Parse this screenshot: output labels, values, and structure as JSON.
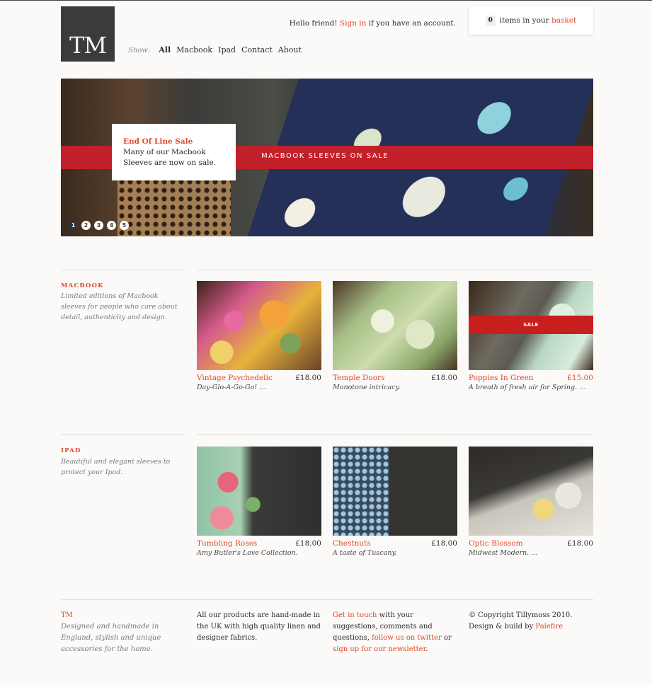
{
  "header": {
    "logo": "TM",
    "show_label": "Show:",
    "nav": [
      "All",
      "Macbook",
      "Ipad",
      "Contact",
      "About"
    ],
    "greeting_pre": "Hello friend! ",
    "sign_in": "Sign in",
    "greeting_post": " if you have an account.",
    "basket_count": "0",
    "basket_text": "items in your ",
    "basket_link": "basket"
  },
  "hero": {
    "card_title": "End Of Line Sale",
    "card_text": "Many of our Macbook Sleeves are now on sale.",
    "band_text": "MACBOOK SLEEVES ON SALE",
    "dots": [
      "1",
      "2",
      "3",
      "4",
      "5"
    ]
  },
  "sections": [
    {
      "title": "MACBOOK",
      "desc": "Limited editions of Macbook sleeves for people who care about detail, authenticity and design.",
      "products": [
        {
          "name": "Vintage Psychedelic",
          "price": "£18.00",
          "desc": "Day-Glo-A-Go-Go! …"
        },
        {
          "name": "Temple Doors",
          "price": "£18.00",
          "desc": "Monotone intricacy."
        },
        {
          "name": "Poppies In Green",
          "price": "£15.00",
          "desc": "A breath of fresh air for Spring. …",
          "badge": "SALE"
        }
      ]
    },
    {
      "title": "IPAD",
      "desc": "Beautiful and elegant sleeves to protect your Ipad.",
      "products": [
        {
          "name": "Tumbling Roses",
          "price": "£18.00",
          "desc": "Amy Butler's Love Collection."
        },
        {
          "name": "Chestnuts",
          "price": "£18.00",
          "desc": "A taste of Tuscany."
        },
        {
          "name": "Optic Blossom",
          "price": "£18.00",
          "desc": "Midwest Modern. …"
        }
      ]
    }
  ],
  "footer": {
    "brand": "TM",
    "brand_desc": "Designed and handmade in England, stylish and unique accessories for the home.",
    "about": "All our products are hand-made in the UK with high quality linen and designer fabrics.",
    "contact_link": "Get in touch",
    "contact_text1": " with your suggestions, comments and questions, ",
    "twitter_link": "follow us on twitter",
    "contact_text2": " or ",
    "newsletter_link": "sign up for our newsletter",
    "contact_text3": ".",
    "copyright": "© Copyright Tillymoss 2010.",
    "credit_pre": "Design & build by ",
    "credit_link": "Palefire"
  }
}
